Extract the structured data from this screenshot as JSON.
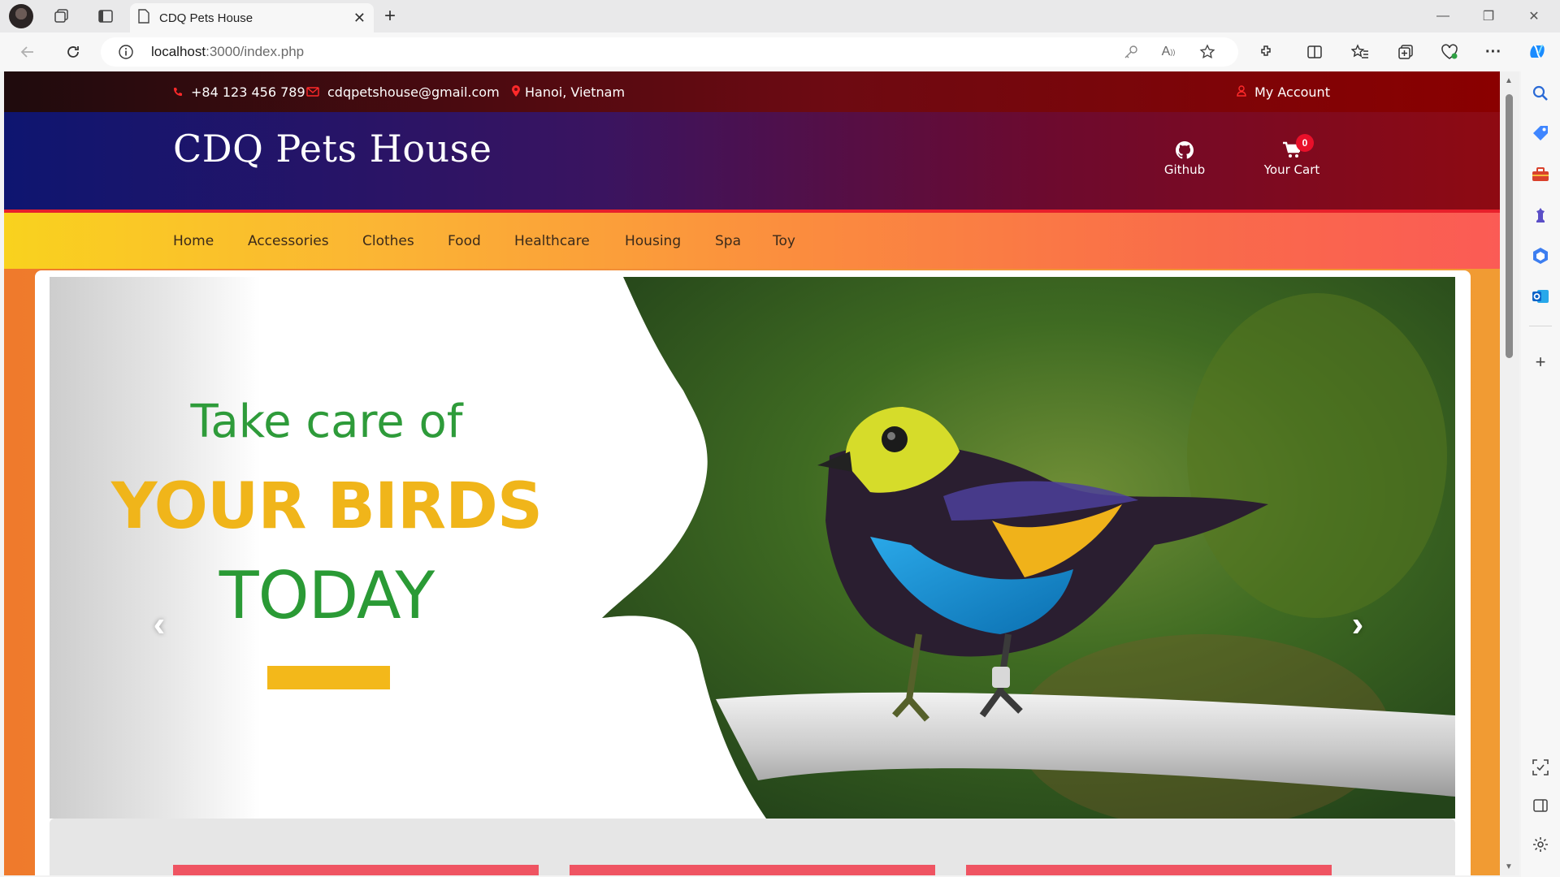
{
  "browser": {
    "tab_title": "CDQ Pets House",
    "url_host": "localhost",
    "url_path": ":3000/index.php"
  },
  "topbar": {
    "phone": "+84 123 456 789",
    "email": "cdqpetshouse@gmail.com",
    "location": "Hanoi, Vietnam",
    "account": "My Account"
  },
  "header": {
    "logo": "CDQ Pets House",
    "github": "Github",
    "cart": "Your Cart",
    "cart_count": "0"
  },
  "nav": {
    "items": [
      "Home",
      "Accessories",
      "Clothes",
      "Food",
      "Healthcare",
      "Housing",
      "Spa",
      "Toy"
    ]
  },
  "slide": {
    "line1": "Take care of",
    "line2": "YOUR BIRDS",
    "line3": "TODAY"
  },
  "colors": {
    "topbar_red": "#8a0000",
    "header_blue": "#0e1570",
    "nav_yellow": "#f9d21e",
    "nav_red": "#fb5b55",
    "slogan_green": "#2e9b3a",
    "slogan_yellow": "#f0b51a",
    "badge_red": "#e8102a"
  }
}
